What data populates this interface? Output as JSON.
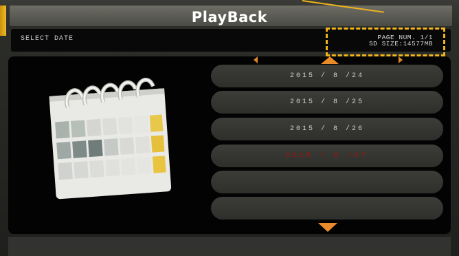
{
  "window": {
    "title": "PlayBack"
  },
  "info_bar": {
    "select_date_label": "SELECT DATE",
    "page_num_label": "PAGE NUM.  1/1",
    "sd_size_label": "SD SIZE:14577MB"
  },
  "date_list": [
    {
      "label": "2015 / 8 /24",
      "selected": false
    },
    {
      "label": "2015 / 8 /25",
      "selected": false
    },
    {
      "label": "2015 / 8 /26",
      "selected": false
    },
    {
      "label": "2015 / 8 /27",
      "selected": true
    },
    {
      "label": "",
      "selected": false
    },
    {
      "label": "",
      "selected": false
    }
  ],
  "icons": {
    "calendar": "calendar-icon",
    "prev_page": "arrow-left-icon",
    "scroll_up": "arrow-up-icon",
    "next_page": "arrow-right-icon",
    "scroll_down": "arrow-down-icon"
  },
  "colors": {
    "accent": "#e98b2a",
    "highlight": "#f2b31b",
    "selected_text": "#8a1a12",
    "title_text": "#ffffff"
  }
}
